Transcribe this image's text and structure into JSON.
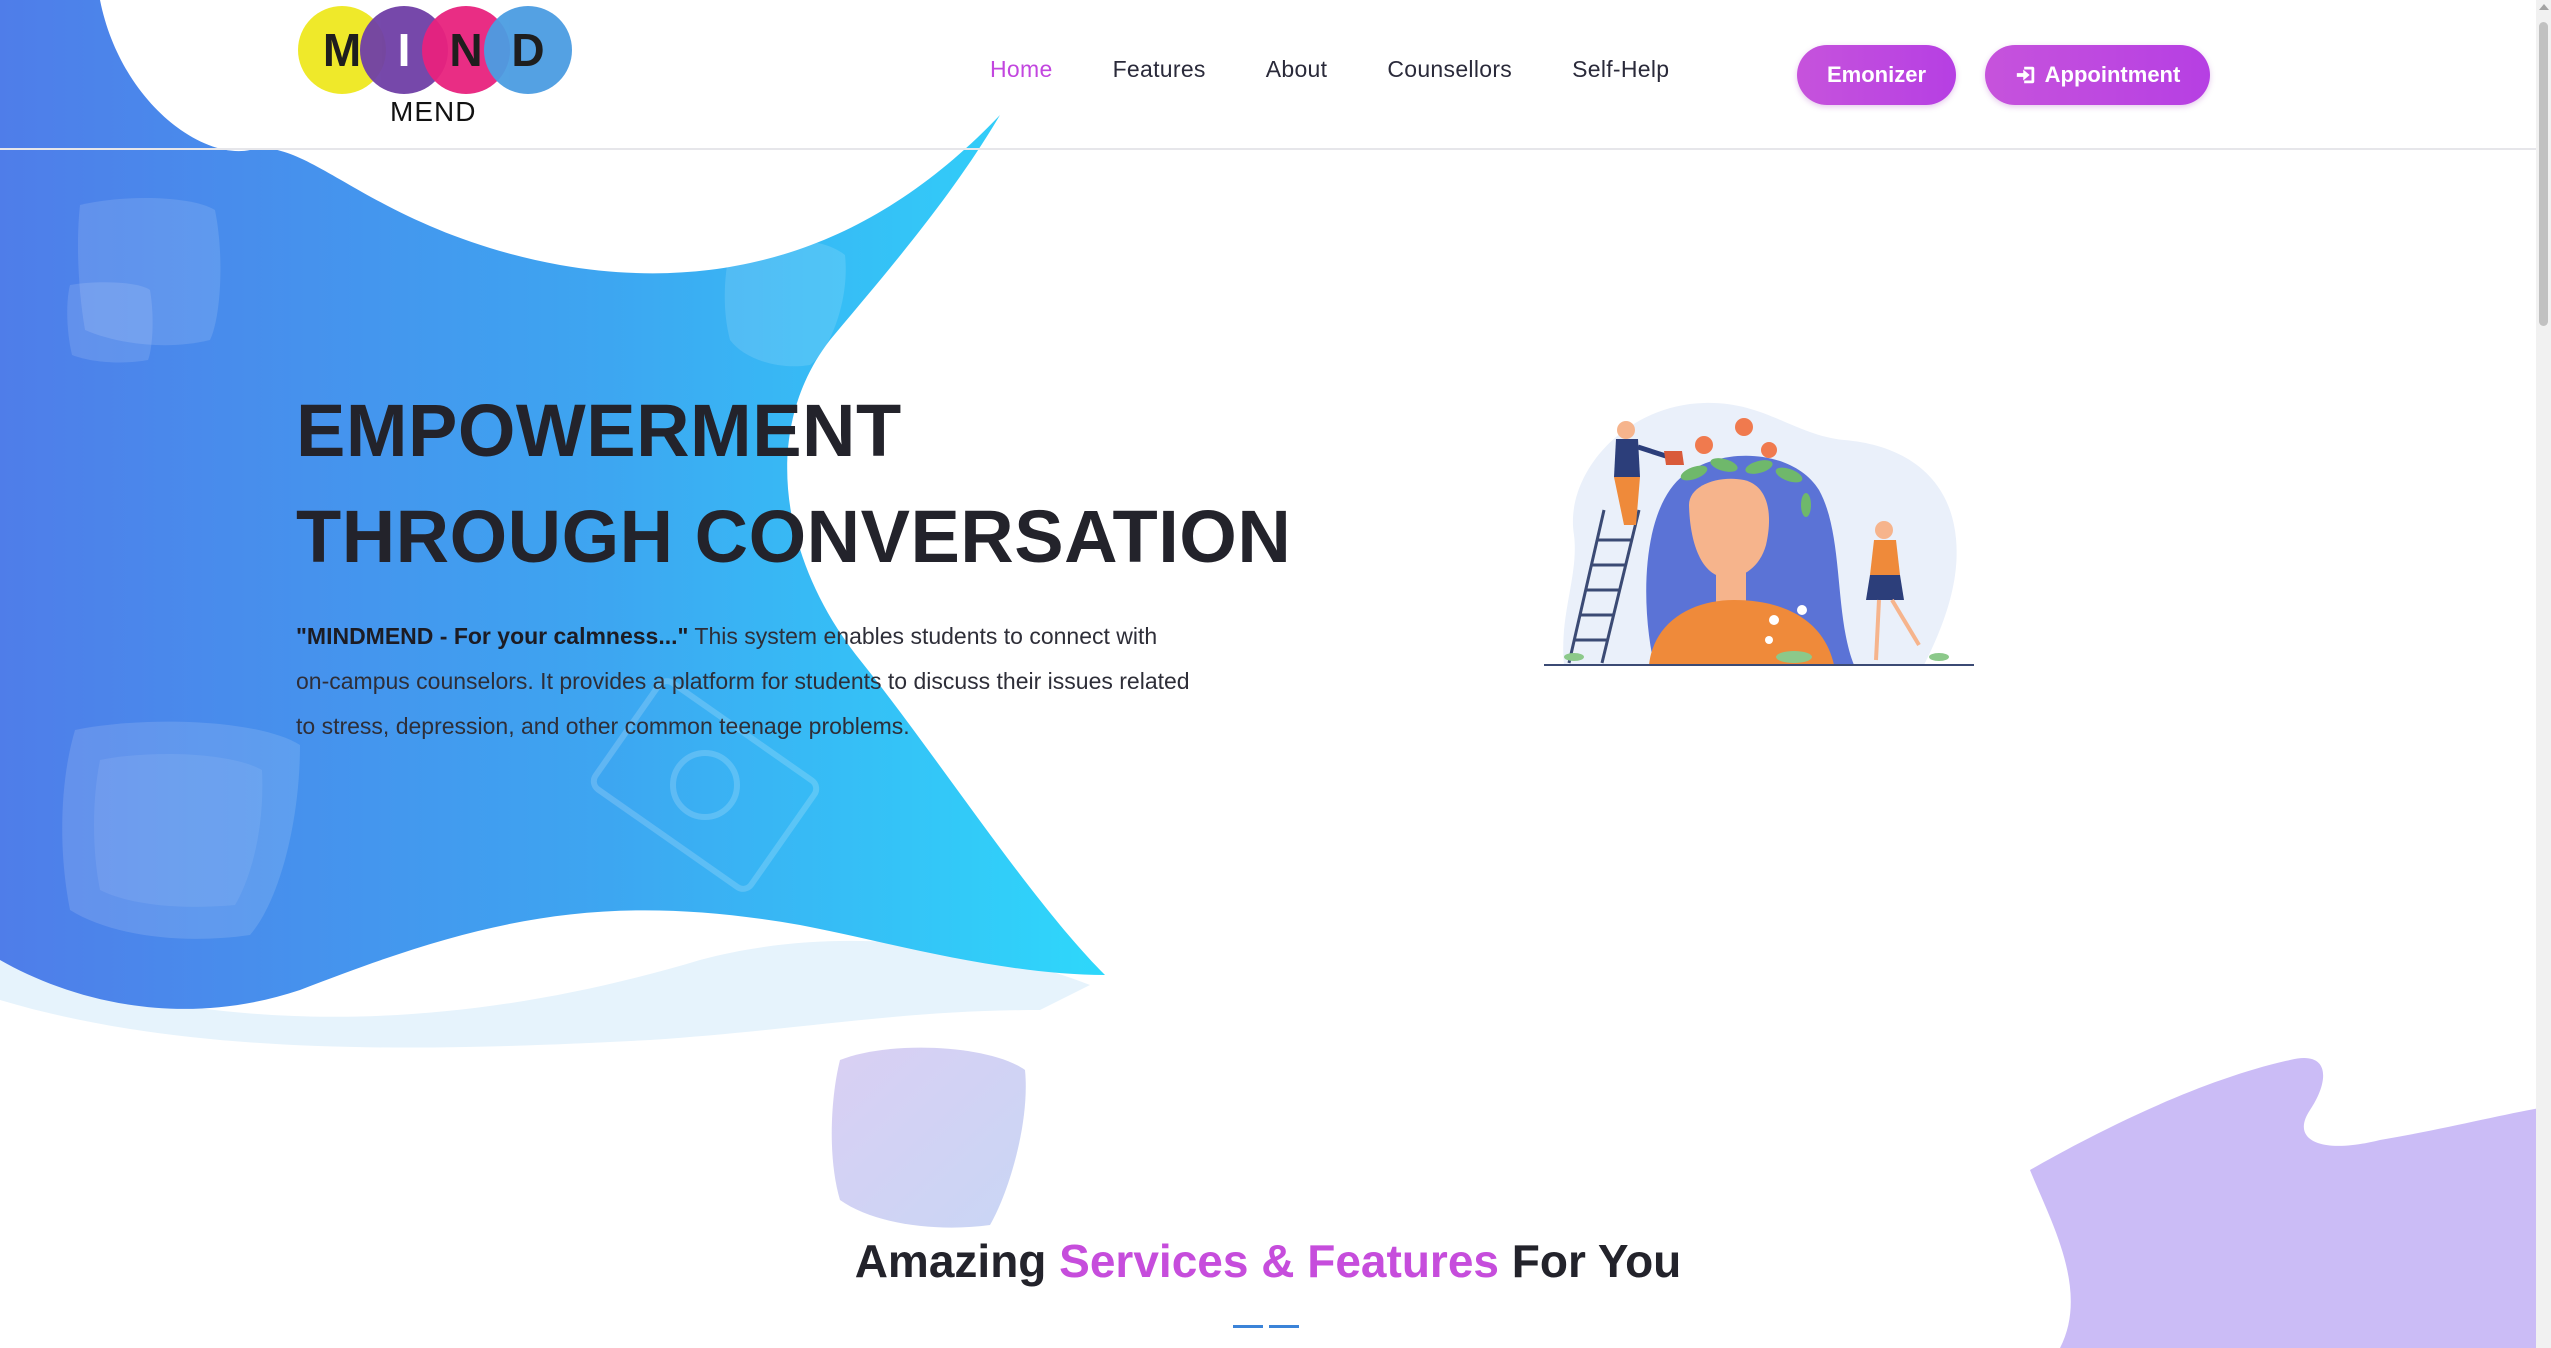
{
  "brand": {
    "letters": [
      "M",
      "I",
      "N",
      "D"
    ],
    "subtitle": "MEND"
  },
  "nav": {
    "items": [
      {
        "label": "Home",
        "active": true
      },
      {
        "label": "Features",
        "active": false
      },
      {
        "label": "About",
        "active": false
      },
      {
        "label": "Counsellors",
        "active": false
      },
      {
        "label": "Self-Help",
        "active": false
      }
    ]
  },
  "actions": {
    "emonizer_label": "Emonizer",
    "appointment_label": "Appointment",
    "appointment_icon": "sign-in-icon"
  },
  "hero": {
    "title_line1": "EMPOWERMENT",
    "title_line2": "THROUGH CONVERSATION",
    "tagline": "\"MINDMEND - For your calmness...\"",
    "description": " This system enables students to connect with on-campus counselors. It provides a platform for students to discuss their issues related to stress, depression, and other common teenage problems."
  },
  "section": {
    "heading_prefix": "Amazing ",
    "heading_accent": "Services & Features",
    "heading_suffix": " For You"
  },
  "colors": {
    "accent": "#c246df",
    "hero_gradient_start": "#4f7de9",
    "hero_gradient_end": "#2ed8fb",
    "underline": "#3b83d8",
    "blob_lavender": "#cbbcf6"
  }
}
